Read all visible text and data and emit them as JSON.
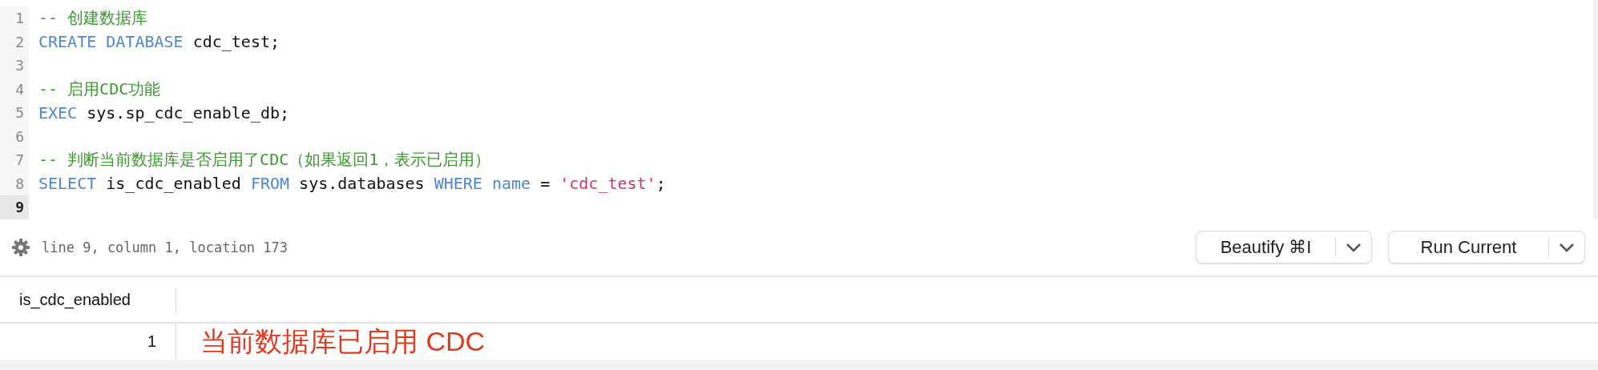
{
  "editor": {
    "lines": [
      {
        "number": "1",
        "current": false,
        "tokens": [
          {
            "kind": "comment",
            "text": "-- 创建数据库"
          }
        ]
      },
      {
        "number": "2",
        "current": false,
        "tokens": [
          {
            "kind": "keyword",
            "text": "CREATE DATABASE"
          },
          {
            "kind": "plain",
            "text": " cdc_test;"
          }
        ]
      },
      {
        "number": "3",
        "current": false
      },
      {
        "number": "4",
        "current": false,
        "tokens": [
          {
            "kind": "comment",
            "text": "-- 启用CDC功能"
          }
        ]
      },
      {
        "number": "5",
        "current": false,
        "tokens": [
          {
            "kind": "keyword",
            "text": "EXEC"
          },
          {
            "kind": "plain",
            "text": " sys.sp_cdc_enable_db;"
          }
        ]
      },
      {
        "number": "6",
        "current": false
      },
      {
        "number": "7",
        "current": false,
        "tokens": [
          {
            "kind": "comment",
            "text": "-- 判断当前数据库是否启用了CDC（如果返回1，表示已启用）"
          }
        ]
      },
      {
        "number": "8",
        "current": false,
        "tokens": [
          {
            "kind": "keyword",
            "text": "SELECT"
          },
          {
            "kind": "plain",
            "text": " is_cdc_enabled "
          },
          {
            "kind": "keyword",
            "text": "FROM"
          },
          {
            "kind": "plain",
            "text": " sys.databases "
          },
          {
            "kind": "keyword",
            "text": "WHERE name"
          },
          {
            "kind": "plain",
            "text": " = "
          },
          {
            "kind": "string",
            "text": "'cdc_test'"
          },
          {
            "kind": "plain",
            "text": ";"
          }
        ]
      },
      {
        "number": "9",
        "current": true
      }
    ]
  },
  "status_bar": {
    "position": "line 9, column 1, location 173"
  },
  "buttons": [
    {
      "label": "Beautify ⌘I"
    },
    {
      "label": "Run Current"
    }
  ],
  "results": {
    "columns": [
      "is_cdc_enabled"
    ],
    "rows": [
      [
        "1"
      ]
    ],
    "annotation": "当前数据库已启用 CDC"
  }
}
